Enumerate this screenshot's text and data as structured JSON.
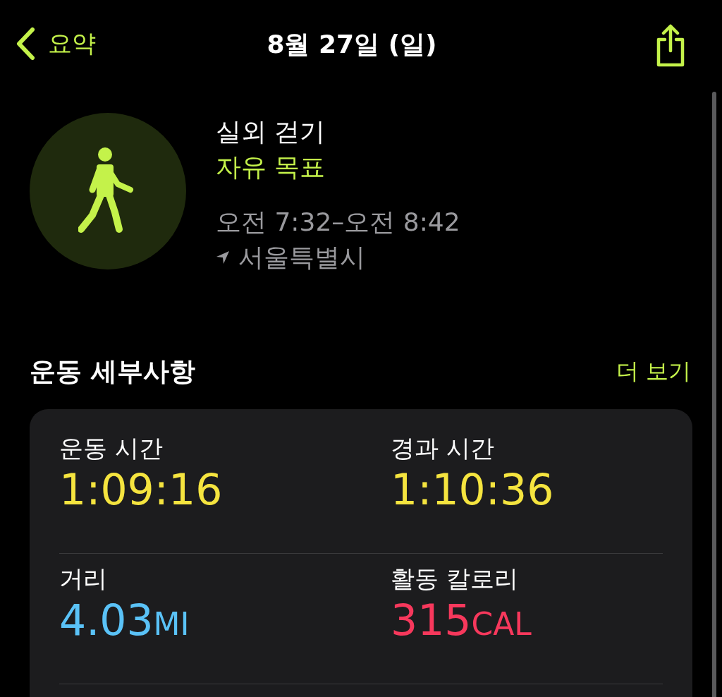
{
  "nav": {
    "back_label": "요약",
    "title": "8월 27일 (일)"
  },
  "workout": {
    "name": "실외 걷기",
    "goal": "자유 목표",
    "time_range": "오전 7:32–오전 8:42",
    "location": "서울특별시"
  },
  "details": {
    "title": "운동 세부사항",
    "more": "더 보기",
    "metrics": [
      {
        "label": "운동 시간",
        "value": "1:09:16",
        "color": "#f5e43f"
      },
      {
        "label": "경과 시간",
        "value": "1:10:36",
        "color": "#f5e43f"
      },
      {
        "label": "거리",
        "value": "4.03",
        "unit": "MI",
        "color": "#5ac2f7"
      },
      {
        "label": "활동 칼로리",
        "value": "315",
        "unit": "CAL",
        "color": "#f7385c"
      }
    ]
  }
}
